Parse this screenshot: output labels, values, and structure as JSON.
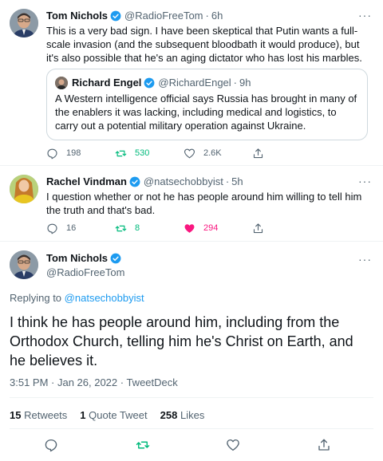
{
  "tweet1": {
    "name": "Tom Nichols",
    "handle": "@RadioFreeTom",
    "time": "6h",
    "text": "This is a very bad sign. I have been skeptical that Putin wants a full-scale invasion (and the subsequent bloodbath it would produce), but it's also possible that he's an aging dictator who has lost his marbles.",
    "quote": {
      "name": "Richard Engel",
      "handle": "@RichardEngel",
      "time": "9h",
      "text": "A Western intelligence official says Russia has brought in many of the enablers it was lacking, including medical and logistics, to carry out a potential military operation against Ukraine."
    },
    "replies": "198",
    "retweets": "530",
    "likes": "2.6K"
  },
  "tweet2": {
    "name": "Rachel Vindman",
    "handle": "@natsechobbyist",
    "time": "5h",
    "text": "I question whether or not he has people around him willing to tell him the truth and that's bad.",
    "replies": "16",
    "retweets": "8",
    "likes": "294"
  },
  "main": {
    "name": "Tom Nichols",
    "handle": "@RadioFreeTom",
    "replying_prefix": "Replying to",
    "replying_to": "@natsechobbyist",
    "text": "I think he has people around him, including from the Orthodox Church, telling him he's Christ on Earth, and he believes it.",
    "timestamp": "3:51 PM · Jan 26, 2022 · TweetDeck",
    "stats": {
      "retweets_num": "15",
      "retweets_label": "Retweets",
      "quotes_num": "1",
      "quotes_label": "Quote Tweet",
      "likes_num": "258",
      "likes_label": "Likes"
    }
  },
  "separators": {
    "dot": "·",
    "more": "···"
  },
  "colors": {
    "accent": "#1d9bf0",
    "retweet": "#00ba7c",
    "like": "#f91880",
    "muted": "#536471"
  }
}
